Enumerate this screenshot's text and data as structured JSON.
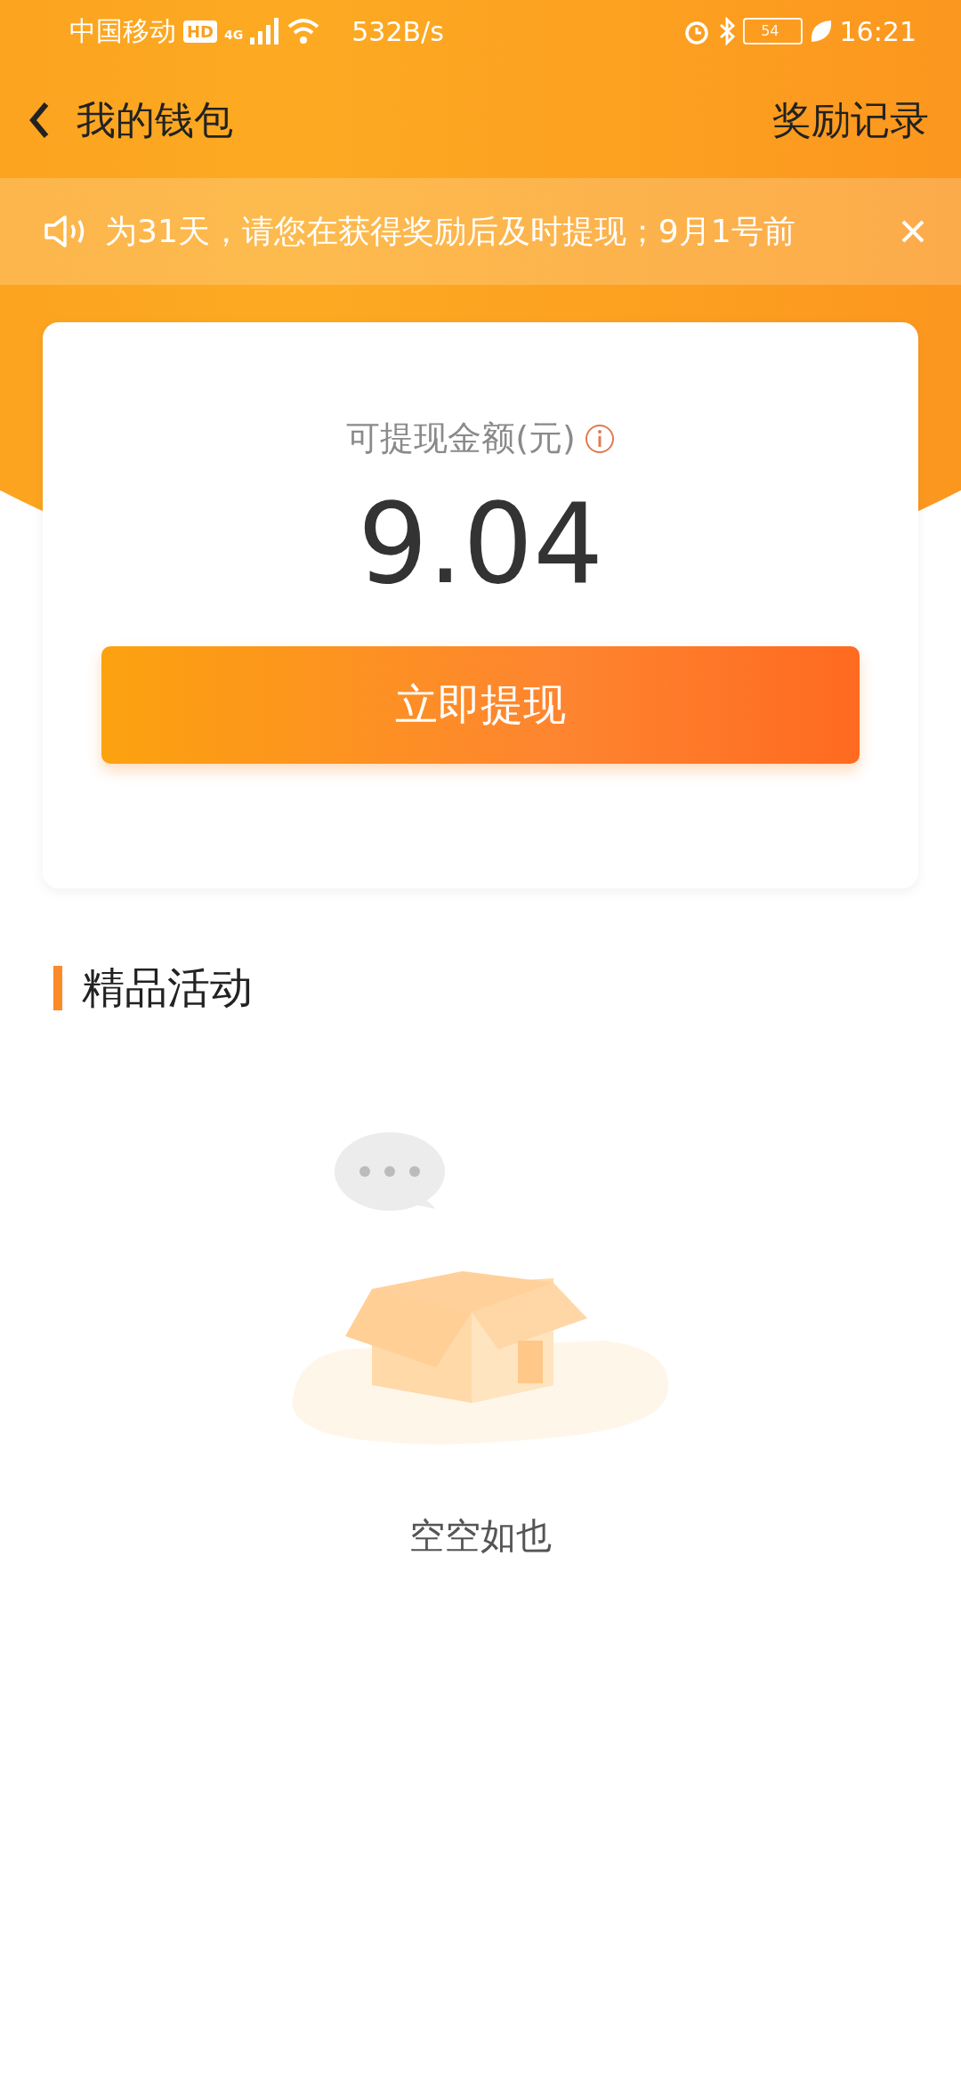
{
  "status_bar": {
    "carrier": "中国移动",
    "hd": "HD",
    "network": "4G",
    "speed": "532B/s",
    "battery": "54",
    "time": "16:21"
  },
  "header": {
    "title": "我的钱包",
    "action": "奖励记录"
  },
  "notice": {
    "text": "为31天，请您在获得奖励后及时提现；9月1号前"
  },
  "balance": {
    "label": "可提现金额(元)",
    "amount": "9.04",
    "button": "立即提现"
  },
  "section": {
    "title": "精品活动"
  },
  "empty": {
    "text": "空空如也"
  }
}
